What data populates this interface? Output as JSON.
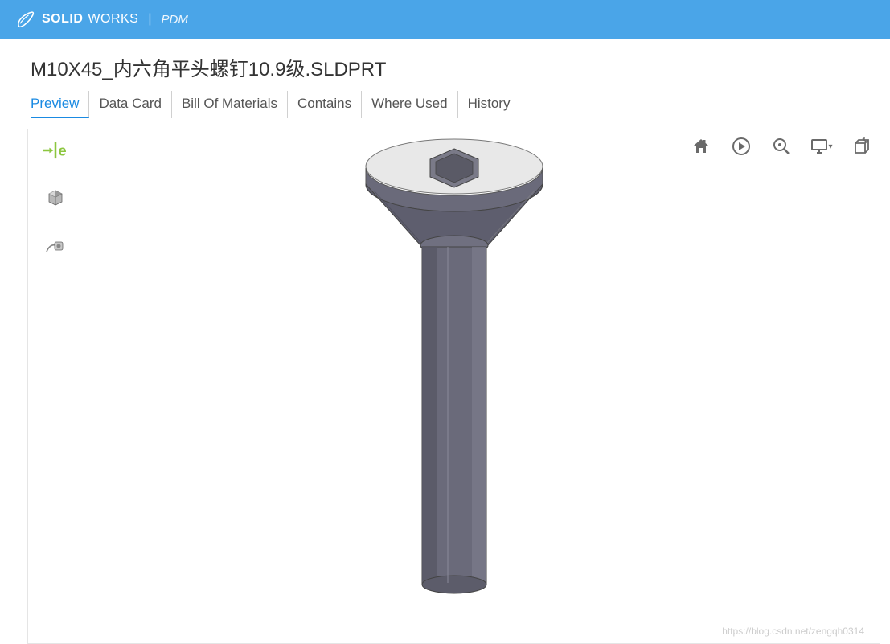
{
  "header": {
    "brand_bold": "SOLID",
    "brand_light": "WORKS",
    "product": "PDM"
  },
  "file": {
    "name": "M10X45_内六角平头螺钉10.9级.SLDPRT"
  },
  "tabs": [
    {
      "label": "Preview",
      "active": true
    },
    {
      "label": "Data Card",
      "active": false
    },
    {
      "label": "Bill Of Materials",
      "active": false
    },
    {
      "label": "Contains",
      "active": false
    },
    {
      "label": "Where Used",
      "active": false
    },
    {
      "label": "History",
      "active": false
    }
  ],
  "left_tools": [
    {
      "name": "edrawings-icon"
    },
    {
      "name": "component-icon"
    },
    {
      "name": "markup-icon"
    }
  ],
  "right_tools": [
    {
      "name": "home-icon"
    },
    {
      "name": "play-icon"
    },
    {
      "name": "zoom-icon"
    },
    {
      "name": "display-icon",
      "has_dropdown": true
    },
    {
      "name": "box-icon"
    }
  ],
  "watermark": "https://blog.csdn.net/zengqh0314"
}
